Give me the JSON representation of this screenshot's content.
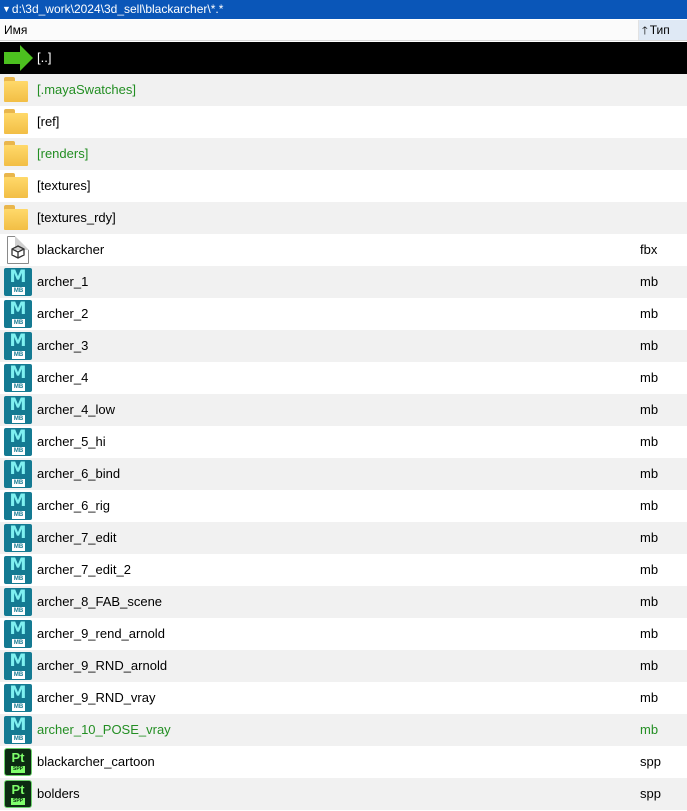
{
  "path": "d:\\3d_work\\2024\\3d_sell\\blackarcher\\*.*",
  "header": {
    "name": "Имя",
    "type": "Тип"
  },
  "rows": [
    {
      "icon": "up-arrow-icon",
      "name": "[..]",
      "type": "",
      "selected": true
    },
    {
      "icon": "folder-icon",
      "name": "[.mayaSwatches]",
      "type": "",
      "green": true
    },
    {
      "icon": "folder-icon",
      "name": "[ref]",
      "type": ""
    },
    {
      "icon": "folder-icon",
      "name": "[renders]",
      "type": "",
      "green": true
    },
    {
      "icon": "folder-icon",
      "name": "[textures]",
      "type": ""
    },
    {
      "icon": "folder-icon",
      "name": "[textures_rdy]",
      "type": ""
    },
    {
      "icon": "fbx-file-icon",
      "name": "blackarcher",
      "type": "fbx"
    },
    {
      "icon": "maya-file-icon",
      "name": "archer_1",
      "type": "mb"
    },
    {
      "icon": "maya-file-icon",
      "name": "archer_2",
      "type": "mb"
    },
    {
      "icon": "maya-file-icon",
      "name": "archer_3",
      "type": "mb"
    },
    {
      "icon": "maya-file-icon",
      "name": "archer_4",
      "type": "mb"
    },
    {
      "icon": "maya-file-icon",
      "name": "archer_4_low",
      "type": "mb"
    },
    {
      "icon": "maya-file-icon",
      "name": "archer_5_hi",
      "type": "mb"
    },
    {
      "icon": "maya-file-icon",
      "name": "archer_6_bind",
      "type": "mb"
    },
    {
      "icon": "maya-file-icon",
      "name": "archer_6_rig",
      "type": "mb"
    },
    {
      "icon": "maya-file-icon",
      "name": "archer_7_edit",
      "type": "mb"
    },
    {
      "icon": "maya-file-icon",
      "name": "archer_7_edit_2",
      "type": "mb"
    },
    {
      "icon": "maya-file-icon",
      "name": "archer_8_FAB_scene",
      "type": "mb"
    },
    {
      "icon": "maya-file-icon",
      "name": "archer_9_rend_arnold",
      "type": "mb"
    },
    {
      "icon": "maya-file-icon",
      "name": "archer_9_RND_arnold",
      "type": "mb"
    },
    {
      "icon": "maya-file-icon",
      "name": "archer_9_RND_vray",
      "type": "mb"
    },
    {
      "icon": "maya-file-icon",
      "name": "archer_10_POSE_vray",
      "type": "mb",
      "green": true
    },
    {
      "icon": "spp-file-icon",
      "name": "blackarcher_cartoon",
      "type": "spp"
    },
    {
      "icon": "spp-file-icon",
      "name": "bolders",
      "type": "spp"
    }
  ],
  "colors": {
    "pathbar": "#0a56b8",
    "selected_row": "#000000",
    "green_text": "#238e23",
    "alt_row": "#f1f1f1"
  }
}
